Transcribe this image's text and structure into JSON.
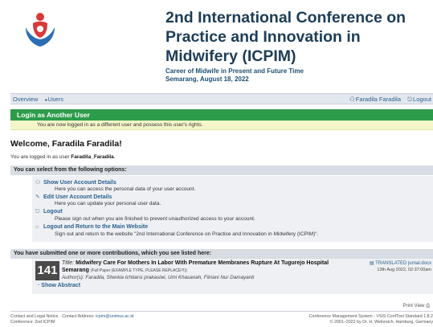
{
  "header": {
    "title": "2nd International Conference on Practice and Innovation in Midwifery (ICPIM)",
    "subtitle_line1": "Career of Midwife in Present and Future Time",
    "subtitle_line2": "Semarang, August 18, 2022"
  },
  "nav": {
    "overview": "Overview",
    "users": "Users",
    "user_name": "Faradila Faradila",
    "logout": "Logout"
  },
  "login_as": {
    "title": "Login as Another User",
    "message": "You are now logged in as a different user and possess this user's rights."
  },
  "welcome": {
    "heading": "Welcome, Faradila Faradila!",
    "logged_prefix": "You are logged in as user",
    "username": "Faradila_Faradila",
    "logged_suffix": "."
  },
  "options": {
    "header": "You can select from the following options:",
    "items": [
      {
        "label": "Show User Account Details",
        "desc": "Here you can access the personal data of your user account."
      },
      {
        "label": "Edit User Account Details",
        "desc": "Here you can update your personal user data."
      },
      {
        "label": "Logout",
        "desc": "Please sign out when you are finished to prevent unauthorized access to your account."
      },
      {
        "label": "Logout and Return to the Main Website",
        "desc": "Sign out and return to the website \"2nd International Conference on Practice and Innovation in Midwifery (ICPIM)\"."
      }
    ]
  },
  "contributions": {
    "header": "You have submitted one or more contributions, which you see listed here:",
    "paper": {
      "id": "141",
      "title_label": "Title:",
      "title": "Midwifery Care For Mothers In Labor With Premature Membranes Rupture At Tugurejo Hospital Semarang",
      "type": "(Full Paper (EXAMPLE TYPE, PLEASE REPLACE!!!))",
      "authors_label": "Author(s):",
      "authors": "Faradila, Sherkia Ichtiarsi prakasiwi, Umi Khasanah, Fitriani Nur Damayanti",
      "show_abstract": "Show Abstract",
      "file": "TRANSLATED jurnal.docx",
      "file_date": "13th Aug 2022, 02:37:00am"
    }
  },
  "print_view": "Print View",
  "footer": {
    "left_line1_prefix": "Contact and Legal Notice · Contact Address:",
    "left_email": "icpim@unimus.ac.id",
    "left_line2": "Conference: 2nd ICPIM",
    "right_line1": "Conference Management System - VSIS ConfTool Standard 1.8.2",
    "right_line2": "© 2001–2022 by Dr. H. Weinreich, Hamburg, Germany"
  }
}
